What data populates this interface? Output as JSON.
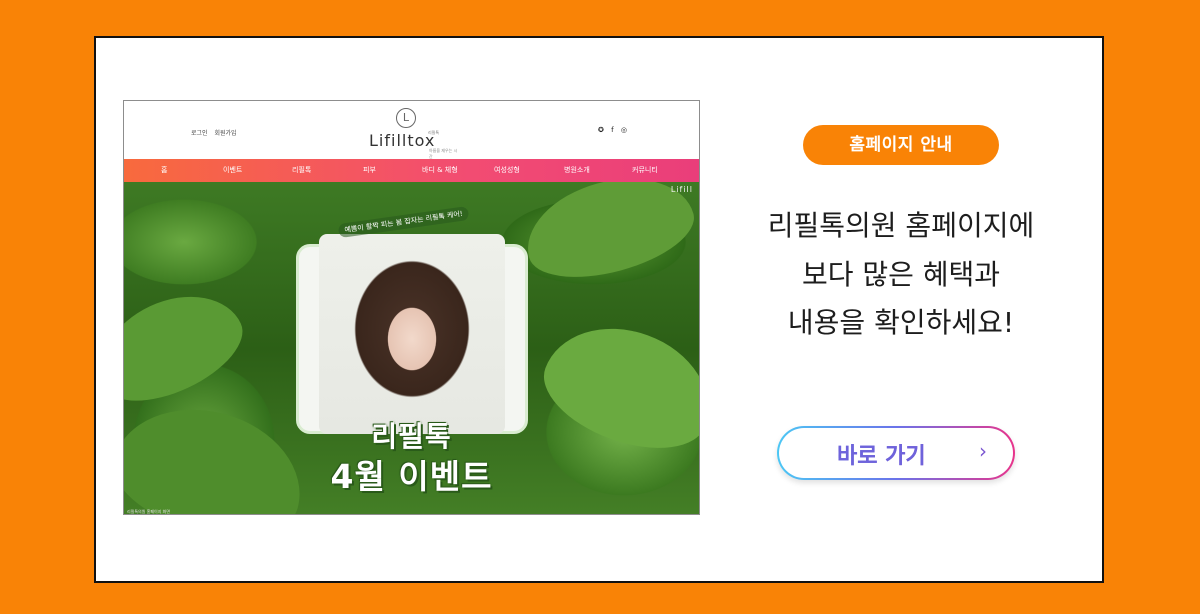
{
  "preview": {
    "auth": [
      "로그인",
      "회원가입"
    ],
    "logo": {
      "text": "Lifilltox",
      "small": "리필톡",
      "tagline": "아름을 재우는 시간"
    },
    "social": [
      "✪",
      "f",
      "◎"
    ],
    "nav": [
      "홈",
      "이벤트",
      "리필톡",
      "피부",
      "바디 & 체형",
      "여성성형",
      "병원소개",
      "커뮤니티"
    ],
    "hero_brand": "Lifill",
    "ribbon": "예쁨이 활짝 피는 봄 잡자는 리필톡 케어!",
    "event_line1": "리필톡",
    "event_line2": "4월 이벤트",
    "footer": "리필톡의원 홈페이지 화면"
  },
  "pill": "홈페이지 안내",
  "message": [
    "리필톡의원 홈페이지에",
    "보다 많은 혜택과",
    "내용을 확인하세요!"
  ],
  "button": {
    "label": "바로 가기",
    "arrow": "›"
  },
  "colors": {
    "background": "#f98306",
    "card": "#ffffff",
    "pill": "#f98306",
    "nav_start": "#f86a3d",
    "nav_end": "#ea3e7a"
  }
}
